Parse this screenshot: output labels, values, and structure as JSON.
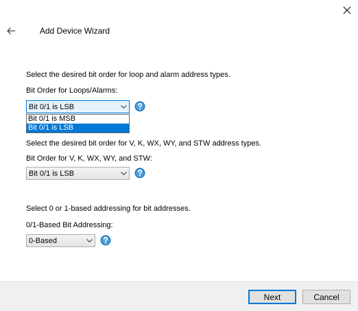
{
  "window": {
    "title": "Add Device Wizard"
  },
  "loops_section": {
    "description": "Select the desired bit order for loop and alarm address types.",
    "label": "Bit Order for Loops/Alarms:",
    "selected": "Bit 0/1 is LSB",
    "options": [
      "Bit 0/1 is MSB",
      "Bit 0/1 is LSB"
    ]
  },
  "vk_section": {
    "description": "Select the desired bit order for V, K, WX, WY, and STW address types.",
    "label": "Bit Order for V, K, WX, WY, and STW:",
    "selected": "Bit 0/1 is LSB"
  },
  "addressing_section": {
    "description": "Select 0 or 1-based addressing for bit addresses.",
    "label": "0/1-Based Bit Addressing:",
    "selected": "0-Based"
  },
  "footer": {
    "next_label": "Next",
    "cancel_label": "Cancel"
  },
  "colors": {
    "accent": "#0078d7",
    "footer_bg": "#f0f0f0",
    "help_icon": "#1e7ac0"
  },
  "icons": {
    "back": "back-arrow-icon",
    "close": "close-icon",
    "help": "help-icon",
    "dropdown": "chevron-down-icon"
  }
}
